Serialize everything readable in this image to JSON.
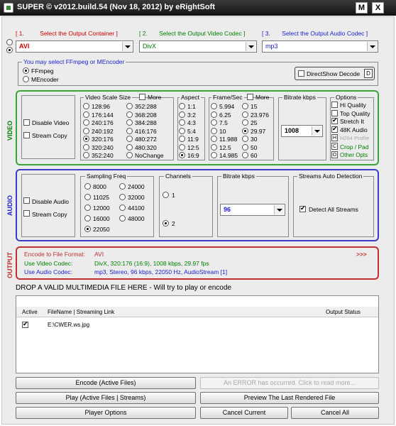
{
  "window": {
    "title": "SUPER © v2012.build.54 (Nov 18, 2012) by eRightSoft",
    "menu_btn": "M",
    "close_btn": "X"
  },
  "step1": {
    "num": "[ 1.",
    "text": "Select the Output Container ]",
    "value": "AVI"
  },
  "step2": {
    "num": "[ 2.",
    "text": "Select the Output Video Codec ]",
    "value": "DivX"
  },
  "step3": {
    "num": "[ 3.",
    "text": "Select the Output Audio Codec ]",
    "value": "mp3"
  },
  "encoder": {
    "title": "You may select FFmpeg or MEncoder",
    "ffmpeg": "FFmpeg",
    "mencoder": "MEncoder",
    "directshow": "DirectShow Decode",
    "directshow_key": "D"
  },
  "video": {
    "side_label": "VIDEO",
    "disable": "Disable Video",
    "stream_copy": "Stream Copy",
    "scale_title": "Video Scale Size",
    "more": "More",
    "scale_col1": [
      "128:96",
      "176:144",
      "240:176",
      "240:192",
      "320:176",
      "320:240",
      "352:240"
    ],
    "scale_col2": [
      "352:288",
      "368:208",
      "384:288",
      "416:176",
      "480:272",
      "480:320",
      "NoChange"
    ],
    "aspect_title": "Aspect",
    "aspects": [
      "1:1",
      "3:2",
      "4:3",
      "5:4",
      "11:9",
      "12:5",
      "16:9"
    ],
    "fps_title": "Frame/Sec",
    "fps_col1": [
      "5.994",
      "6.25",
      "7.5",
      "10",
      "11.988",
      "12.5",
      "14.985"
    ],
    "fps_col2": [
      "15",
      "23.976",
      "25",
      "29.97",
      "30",
      "50",
      "60"
    ],
    "bitrate_title": "Bitrate  kbps",
    "bitrate_value": "1008",
    "options_title": "Options",
    "options": [
      "Hi Quality",
      "Top Quality",
      "Stretch It",
      "48K Audio"
    ],
    "h264": "H264 Profile",
    "h264_key": "H",
    "crop": "Crop / Pad",
    "crop_key": "C",
    "other": "Other Opts",
    "other_key": "O"
  },
  "audio": {
    "side_label": "AUDIO",
    "disable": "Disable Audio",
    "stream_copy": "Stream Copy",
    "freq_title": "Sampling Freq",
    "freq_col1": [
      "8000",
      "11025",
      "12000",
      "16000",
      "22050"
    ],
    "freq_col2": [
      "24000",
      "32000",
      "44100",
      "48000"
    ],
    "channels_title": "Channels",
    "channel_1": "1",
    "channel_2": "2",
    "bitrate_title": "Bitrate  kbps",
    "bitrate_value": "96",
    "streams_title": "Streams Auto Detection",
    "detect_all": "Detect All Streams"
  },
  "output": {
    "side_label": "OUTPUT",
    "format_label": "Encode to File Format:",
    "format_value": "AVI",
    "more": ">>>",
    "video_label": "Use Video Codec:",
    "video_value": "DivX,  320:176 (16:9),  1008 kbps,  29.97 fps",
    "audio_label": "Use Audio Codec:",
    "audio_value": "mp3,  Stereo,  96 kbps,  22050 Hz,  AudioStream [1]"
  },
  "drop_hint": "DROP A VALID MULTIMEDIA FILE HERE - Will try to play or encode",
  "file_list": {
    "col_active": "Active",
    "col_filename": "FileName  |  Streaming Link",
    "col_status": "Output Status",
    "rows": [
      {
        "file": "E:\\CWER.ws.jpg",
        "status": ""
      }
    ]
  },
  "buttons": {
    "encode": "Encode (Active Files)",
    "error": "An ERROR has occurred. Click to read more...",
    "play": "Play (Active Files | Streams)",
    "preview": "Preview The Last Rendered File",
    "player_options": "Player Options",
    "cancel_current": "Cancel Current",
    "cancel_all": "Cancel All"
  },
  "colors": {
    "step1": "#cc0000",
    "step2": "#008000",
    "step3": "#2020cc",
    "video_group": "#3aa63a",
    "audio_group": "#3c3cc8",
    "output_group": "#c03030"
  }
}
